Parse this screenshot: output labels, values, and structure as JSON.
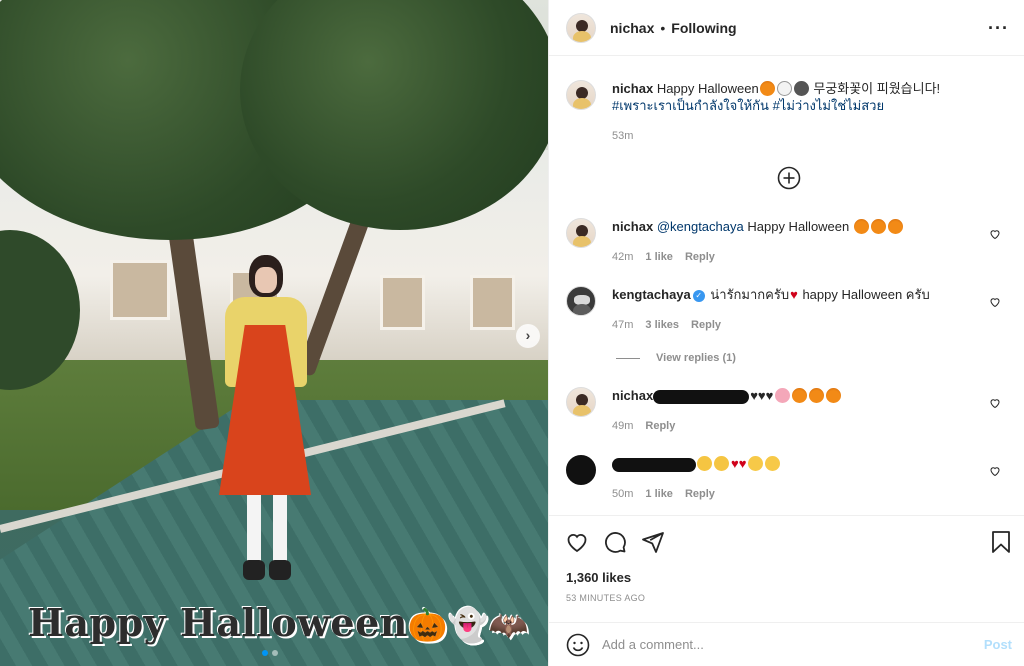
{
  "post": {
    "image_text": "Happy Halloween",
    "slide_count": 2,
    "active_slide": 1
  },
  "header": {
    "username": "nichax",
    "separator": "•",
    "follow_status": "Following",
    "more_icon": "more-horizontal-icon"
  },
  "caption": {
    "username": "nichax",
    "text": "Happy Halloween",
    "text_korean": "무궁화꽃이 피웠습니다!",
    "hashtag1": "#เพราะเราเป็นกำลังใจให้กัน",
    "hashtag2": "#ไม่ว่างไม่ใช่ไม่สวย",
    "time": "53m"
  },
  "load_more_icon": "plus-circle-icon",
  "comments": [
    {
      "username": "nichax",
      "mention": "@kengtachaya",
      "text": "Happy Halloween",
      "time": "42m",
      "likes": "1 like",
      "reply": "Reply"
    },
    {
      "username": "kengtachaya",
      "text_thai": "น่ารักมากครับ",
      "text": "happy Halloween ครับ",
      "time": "47m",
      "likes": "3 likes",
      "reply": "Reply",
      "view_replies": "View replies (1)"
    },
    {
      "username": "nichax",
      "time": "49m",
      "reply": "Reply"
    },
    {
      "time": "50m",
      "likes": "1 like",
      "reply": "Reply"
    }
  ],
  "footer": {
    "likes": "1,360 likes",
    "time_ago": "53 MINUTES AGO",
    "comment_placeholder": "Add a comment...",
    "post_label": "Post"
  },
  "colors": {
    "link": "#00376b",
    "muted": "#8e8e8e",
    "post_button": "#b2dffc",
    "active_dot": "#0095f6",
    "text": "#262626"
  }
}
